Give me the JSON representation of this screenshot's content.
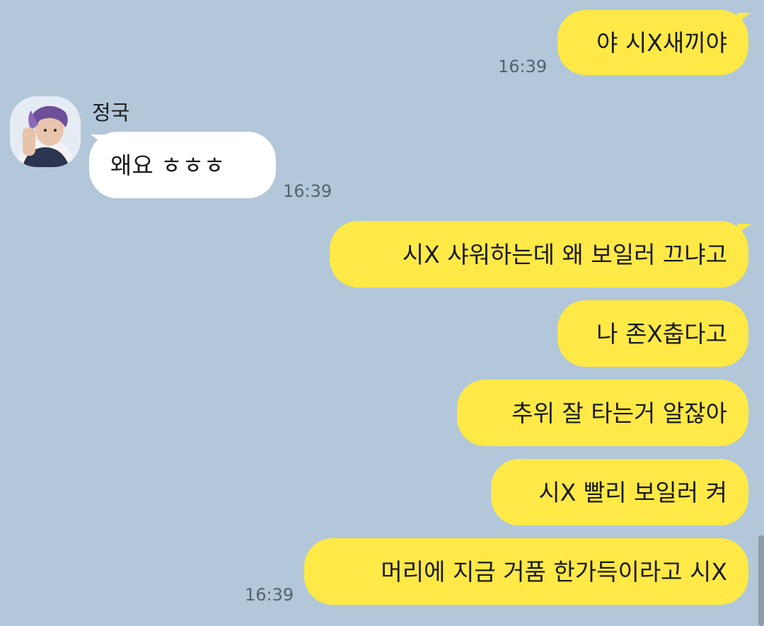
{
  "chat": {
    "contact_name": "정국",
    "avatar_icon": "profile-photo-avatar",
    "colors": {
      "background": "#b2c7d9",
      "my_bubble": "#fee946",
      "their_bubble": "#ffffff"
    },
    "messages": [
      {
        "sender": "me",
        "text": "야 시X새끼야",
        "time": "16:39"
      },
      {
        "sender": "정국",
        "text": "왜요 ㅎㅎㅎ",
        "time": "16:39"
      },
      {
        "sender": "me",
        "text": "시X 샤워하는데 왜 보일러 끄냐고",
        "time": ""
      },
      {
        "sender": "me",
        "text": "나 존X춥다고",
        "time": ""
      },
      {
        "sender": "me",
        "text": "추위 잘 타는거 알잖아",
        "time": ""
      },
      {
        "sender": "me",
        "text": "시X 빨리 보일러 켜",
        "time": ""
      },
      {
        "sender": "me",
        "text": "머리에 지금 거품 한가득이라고 시X",
        "time": "16:39"
      }
    ]
  }
}
